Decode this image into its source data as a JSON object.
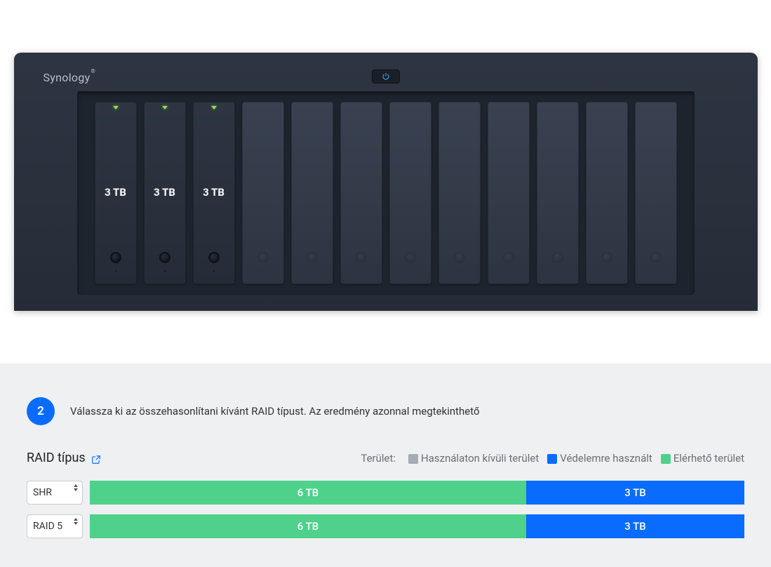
{
  "brand": "Synology",
  "nas": {
    "bay_count": 12,
    "active_bays": [
      {
        "size_label": "3 TB"
      },
      {
        "size_label": "3 TB"
      },
      {
        "size_label": "3 TB"
      }
    ]
  },
  "step": {
    "number": "2",
    "text": "Válassza ki az összehasonlítani kívánt RAID típust. Az eredmény azonnal megtekinthető"
  },
  "raid_type_label": "RAID típus",
  "legend": {
    "label": "Terület:",
    "unused": "Használaton kívüli terület",
    "protection": "Védelemre használt",
    "available": "Elérhető terület"
  },
  "raid_rows": [
    {
      "type_value": "SHR",
      "segments": [
        {
          "kind": "available",
          "label": "6 TB",
          "tb": 6
        },
        {
          "kind": "protection",
          "label": "3 TB",
          "tb": 3
        }
      ]
    },
    {
      "type_value": "RAID 5",
      "segments": [
        {
          "kind": "available",
          "label": "6 TB",
          "tb": 6
        },
        {
          "kind": "protection",
          "label": "3 TB",
          "tb": 3
        }
      ]
    }
  ],
  "chart_data": {
    "type": "bar",
    "title": "RAID capacity comparison",
    "xlabel": "",
    "ylabel": "TB",
    "categories": [
      "SHR",
      "RAID 5"
    ],
    "series": [
      {
        "name": "Elérhető terület",
        "values": [
          6,
          6
        ]
      },
      {
        "name": "Védelemre használt",
        "values": [
          3,
          3
        ]
      },
      {
        "name": "Használaton kívüli terület",
        "values": [
          0,
          0
        ]
      }
    ],
    "ylim": [
      0,
      9
    ]
  }
}
